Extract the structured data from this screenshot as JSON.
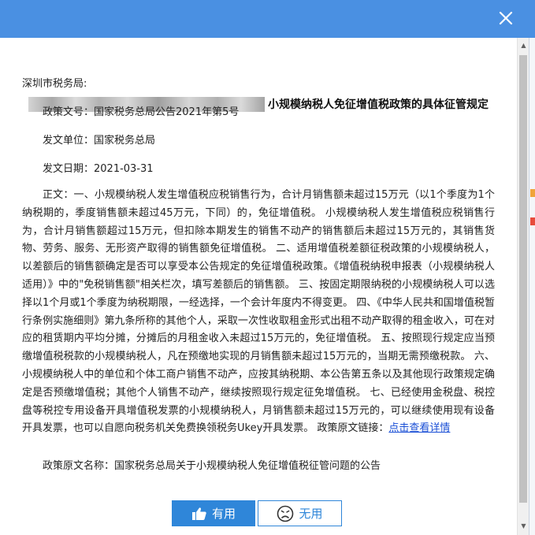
{
  "dialog": {
    "heading_suffix": "小规模纳税人免征增值税政策的具体征管规定",
    "addressee": "深圳市税务局:",
    "doc_number": "政策文号：国家税务总局公告2021年第5号",
    "issuer": "发文单位：国家税务总局",
    "issue_date": "发文日期：2021-03-31",
    "body_text": "正文：一、小规模纳税人发生增值税应税销售行为，合计月销售额未超过15万元（以1个季度为1个纳税期的，季度销售额未超过45万元，下同）的，免征增值税。 小规模纳税人发生增值税应税销售行为，合计月销售额超过15万元，但扣除本期发生的销售不动产的销售额后未超过15万元的，其销售货物、劳务、服务、无形资产取得的销售额免征增值税。 二、适用增值税差额征税政策的小规模纳税人，以差额后的销售额确定是否可以享受本公告规定的免征增值税政策。《增值税纳税申报表（小规模纳税人适用）》中的\"免税销售额\"相关栏次，填写差额后的销售额。 三、按固定期限纳税的小规模纳税人可以选择以1个月或1个季度为纳税期限，一经选择，一个会计年度内不得变更。 四、《中华人民共和国增值税暂行条例实施细则》第九条所称的其他个人，采取一次性收取租金形式出租不动产取得的租金收入，可在对应的租赁期内平均分摊，分摊后的月租金收入未超过15万元的，免征增值税。 五、按照现行规定应当预缴增值税税款的小规模纳税人，凡在预缴地实现的月销售额未超过15万元的，当期无需预缴税款。 六、小规模纳税人中的单位和个体工商户销售不动产，应按其纳税期、本公告第五条以及其他现行政策规定确定是否预缴增值税；其他个人销售不动产，继续按照现行规定征免增值税。 七、已经使用金税盘、税控盘等税控专用设备开具增值税发票的小规模纳税人，月销售额未超过15万元的，可以继续使用现有设备开具发票，也可以自愿向税务机关免费换领税务Ukey开具发票。 政策原文链接：",
    "detail_link": "点击查看详情",
    "original_title": "政策原文名称：国家税务总局关于小规模纳税人免征增值税征管问题的公告"
  },
  "buttons": {
    "useful_label": "有用",
    "useless_label": "无用"
  },
  "icons": {
    "close": "close-icon",
    "useful": "thumbs-up-icon",
    "useless": "sad-face-icon"
  },
  "colors": {
    "titlebar": "#4a90e2",
    "primary_button": "#2f86d9",
    "link": "#1a4fd6"
  }
}
